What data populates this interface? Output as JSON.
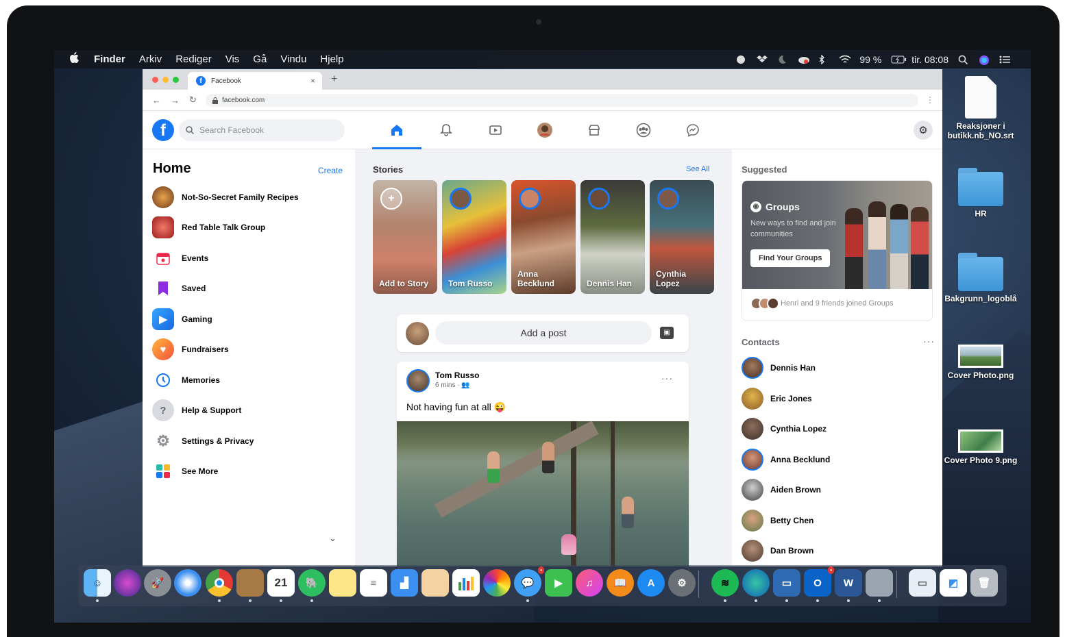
{
  "menubar": {
    "app_name": "Finder",
    "menus": [
      "Arkiv",
      "Rediger",
      "Vis",
      "Gå",
      "Vindu",
      "Hjelp"
    ],
    "battery": "99 %",
    "clock": "tir. 08:08"
  },
  "desktop_icons": [
    {
      "label": "Reaksjoner i butikk.nb_NO.srt",
      "icon": "document-icon"
    },
    {
      "label": "HR",
      "icon": "folder-icon"
    },
    {
      "label": "Bakgrunn_logoblå",
      "icon": "folder-icon"
    },
    {
      "label": "Cover Photo.png",
      "icon": "image-icon"
    },
    {
      "label": "Cover Photo 9.png",
      "icon": "image-icon"
    }
  ],
  "browser": {
    "tab_title": "Facebook",
    "url": "facebook.com"
  },
  "fb": {
    "search_placeholder": "Search Facebook",
    "nav": [
      "home-icon",
      "bell-icon",
      "watch-icon",
      "profile-avatar",
      "marketplace-icon",
      "groups-icon",
      "messenger-icon"
    ],
    "left": {
      "title": "Home",
      "create": "Create",
      "items": [
        {
          "label": "Not-So-Secret Family Recipes",
          "icon": "group-photo-icon",
          "color": "#a0522d"
        },
        {
          "label": "Red Table Talk Group",
          "icon": "group-photo-icon",
          "color": "#c0392b"
        },
        {
          "label": "Events",
          "icon": "calendar-icon",
          "color": "#f02849"
        },
        {
          "label": "Saved",
          "icon": "bookmark-icon",
          "color": "#8e2de2"
        },
        {
          "label": "Gaming",
          "icon": "gaming-icon",
          "color": "#1a8cff"
        },
        {
          "label": "Fundraisers",
          "icon": "heart-icon",
          "color": "#f5533d"
        },
        {
          "label": "Memories",
          "icon": "clock-icon",
          "color": "#1877f2"
        },
        {
          "label": "Help & Support",
          "icon": "question-icon",
          "color": "#8a8d91"
        },
        {
          "label": "Settings & Privacy",
          "icon": "gear-icon",
          "color": "#8a8d91"
        },
        {
          "label": "See More",
          "icon": "grid-icon",
          "color": "#2abba7"
        }
      ]
    },
    "stories": {
      "title": "Stories",
      "see_all": "See All",
      "items": [
        {
          "name": "Add to Story"
        },
        {
          "name": "Tom Russo"
        },
        {
          "name": "Anna Becklund"
        },
        {
          "name": "Dennis Han"
        },
        {
          "name": "Cynthia Lopez"
        }
      ]
    },
    "composer": {
      "placeholder": "Add a post"
    },
    "post": {
      "author": "Tom Russo",
      "meta": "6 mins · 👥",
      "text": "Not having fun at all 😜"
    },
    "right": {
      "suggested_title": "Suggested",
      "group_card": {
        "title": "Groups",
        "description": "New ways to find and join communities",
        "button": "Find Your Groups",
        "footer": "Henri and 9 friends joined Groups"
      },
      "contacts_title": "Contacts",
      "contacts": [
        "Dennis Han",
        "Eric Jones",
        "Cynthia Lopez",
        "Anna Becklund",
        "Aiden Brown",
        "Betty Chen",
        "Dan Brown"
      ]
    }
  },
  "dock": {
    "apps": [
      "Finder",
      "Siri",
      "Launchpad",
      "Safari",
      "Chrome",
      "Notes",
      "Calendar",
      "Evernote",
      "Stickies",
      "Reminders",
      "Keynote",
      "Preview",
      "Numbers",
      "Photos",
      "Messages",
      "FaceTime",
      "Music",
      "Books",
      "App Store",
      "System Preferences",
      "Spotify",
      "Edge",
      "Screen",
      "Outlook",
      "Word",
      "Screenshot",
      "Downloads",
      "Documents",
      "Trash"
    ],
    "calendar_day": "21"
  }
}
